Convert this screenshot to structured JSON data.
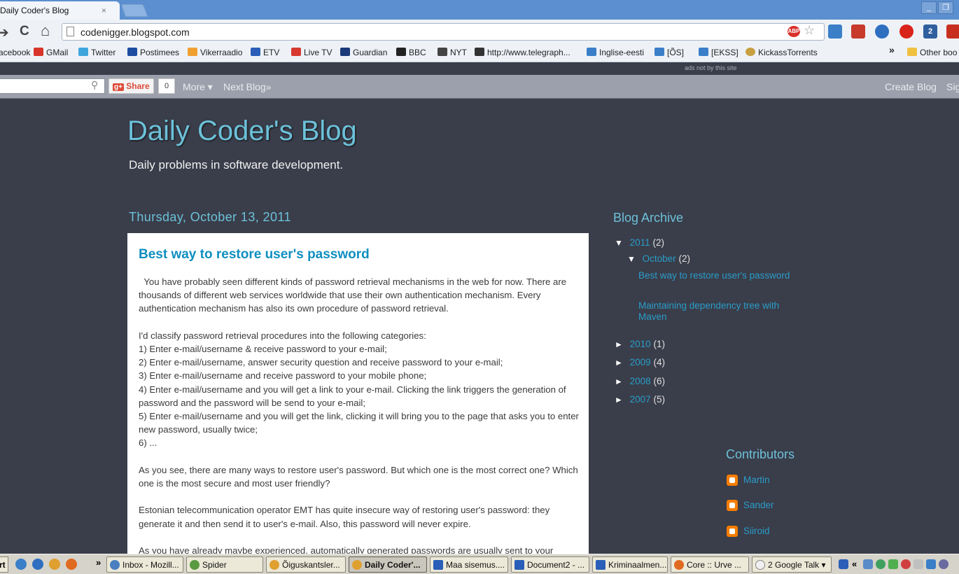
{
  "browser": {
    "tab_title": "Daily Coder's Blog",
    "tab_close": "×",
    "url": "codenigger.blogspot.com",
    "back": "➔",
    "reload": "C",
    "home": "⌂",
    "star": "☆",
    "win_min": "_",
    "win_restore": "❐",
    "extensions": [
      "ABP",
      "",
      "",
      "",
      "",
      "2",
      ""
    ],
    "bookmarks": [
      "acebook",
      "GMail",
      "Twitter",
      "Postimees",
      "Vikerraadio",
      "ETV",
      "Live TV",
      "Guardian",
      "BBC",
      "NYT",
      "http://www.telegraph...",
      "Inglise-eesti",
      "[ÕS]",
      "[EKSS]",
      "KickassTorrents"
    ],
    "bookmarks_overflow": "»",
    "other_bookmarks": "Other boo"
  },
  "navbar": {
    "ads_text": "ads not by this site",
    "share_label": "Share",
    "share_count": "0",
    "more": "More ▾",
    "next_blog": "Next Blog»",
    "create_blog": "Create Blog",
    "sign_in": "Sig"
  },
  "blog": {
    "title": "Daily Coder's Blog",
    "description": "Daily problems in software development.",
    "post_date": "Thursday, October 13, 2011",
    "post_title": "Best way to restore user's password",
    "post_paragraphs": [
      [
        "  You have probably seen different kinds of password retrieval mechanisms in the web for now. There are thousands of different web services worldwide that use their own authentication mechanism. Every authentication mechanism has also its own procedure of password retrieval."
      ],
      [
        "I'd classify password retrieval procedures into the following categories:",
        "1) Enter e-mail/username & receive password to your e-mail;",
        "2) Enter e-mail/username, answer security question and receive password to your e-mail;",
        "3) Enter e-mail/username and receive password to your mobile phone;",
        "4) Enter e-mail/username and you will get a link to your e-mail. Clicking the link triggers the generation of password and the password will be send to your e-mail;",
        "5) Enter e-mail/username and you will get the link, clicking it will bring you to the page that asks you to enter new password, usually twice;",
        "6) ..."
      ],
      [
        "As you see, there are many ways to restore user's password. But which one is the most correct one? Which one is the most secure and most user friendly?"
      ],
      [
        "Estonian telecommunication operator EMT has quite insecure way of restoring user's password: they generate it and then send it to user's e-mail. Also, this password will never expire."
      ],
      [
        "As you have already maybe experienced, automatically generated passwords are usually sent to your"
      ]
    ]
  },
  "sidebar": {
    "archive_heading": "Blog Archive",
    "archive": [
      {
        "tri": "▼",
        "label": "2011",
        "count": "(2)"
      },
      {
        "tri": "▼",
        "label": "October",
        "count": "(2)"
      },
      {
        "tri": "►",
        "label": "2010",
        "count": "(1)"
      },
      {
        "tri": "►",
        "label": "2009",
        "count": "(4)"
      },
      {
        "tri": "►",
        "label": "2008",
        "count": "(6)"
      },
      {
        "tri": "►",
        "label": "2007",
        "count": "(5)"
      }
    ],
    "archive_posts": [
      "Best way to restore user's password",
      "Maintaining dependency tree with Maven"
    ],
    "contributors_heading": "Contributors",
    "contributors": [
      "Martin",
      "Sander",
      "Siiroid"
    ]
  },
  "taskbar": {
    "start": "rt",
    "overflow": "»",
    "tasks": [
      "Inbox - Mozill...",
      "Spider",
      "Õiguskantsler...",
      "Daily Coder'...",
      "Maa sisemus....",
      "Document2 - ...",
      "Kriminaalmen...",
      "Core :: Urve ...",
      "2 Google Talk ▾"
    ],
    "tray_label": "«"
  },
  "colors": {
    "page_bg": "#3a3d4a",
    "accent": "#6cc1d9",
    "link": "#2a9dc8"
  }
}
